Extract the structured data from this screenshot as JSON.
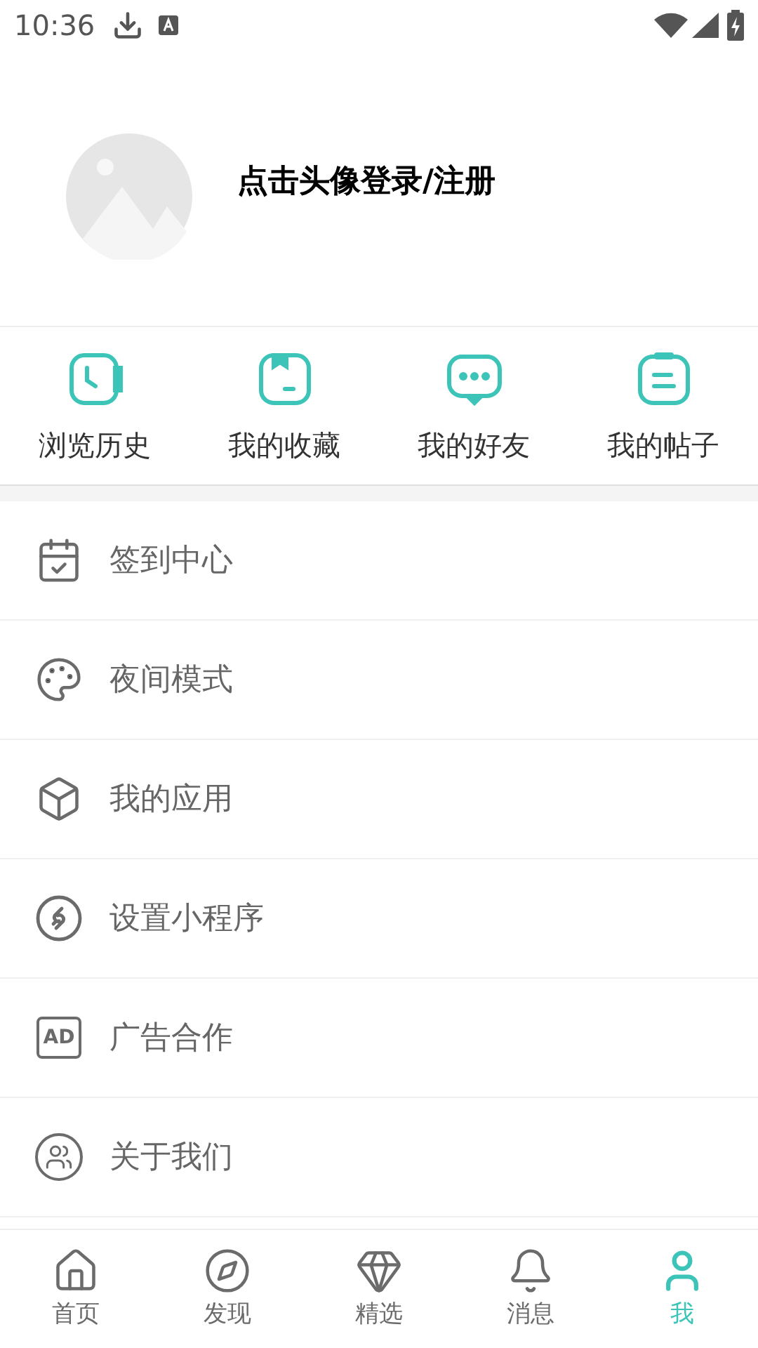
{
  "status_bar": {
    "time": "10:36"
  },
  "profile": {
    "login_prompt": "点击头像登录/注册"
  },
  "quick_links": [
    {
      "kind": "history",
      "label": "浏览历史"
    },
    {
      "kind": "favorites",
      "label": "我的收藏"
    },
    {
      "kind": "friends",
      "label": "我的好友"
    },
    {
      "kind": "posts",
      "label": "我的帖子"
    }
  ],
  "menu": [
    {
      "kind": "checkin",
      "label": "签到中心"
    },
    {
      "kind": "night",
      "label": "夜间模式"
    },
    {
      "kind": "apps",
      "label": "我的应用"
    },
    {
      "kind": "miniprogram",
      "label": "设置小程序"
    },
    {
      "kind": "ads",
      "label": "广告合作",
      "icon_text": "AD"
    },
    {
      "kind": "about",
      "label": "关于我们"
    }
  ],
  "bottom_nav": [
    {
      "kind": "home",
      "label": "首页",
      "selected": false
    },
    {
      "kind": "discover",
      "label": "发现",
      "selected": false
    },
    {
      "kind": "featured",
      "label": "精选",
      "selected": false
    },
    {
      "kind": "messages",
      "label": "消息",
      "selected": false
    },
    {
      "kind": "me",
      "label": "我",
      "selected": true
    }
  ]
}
